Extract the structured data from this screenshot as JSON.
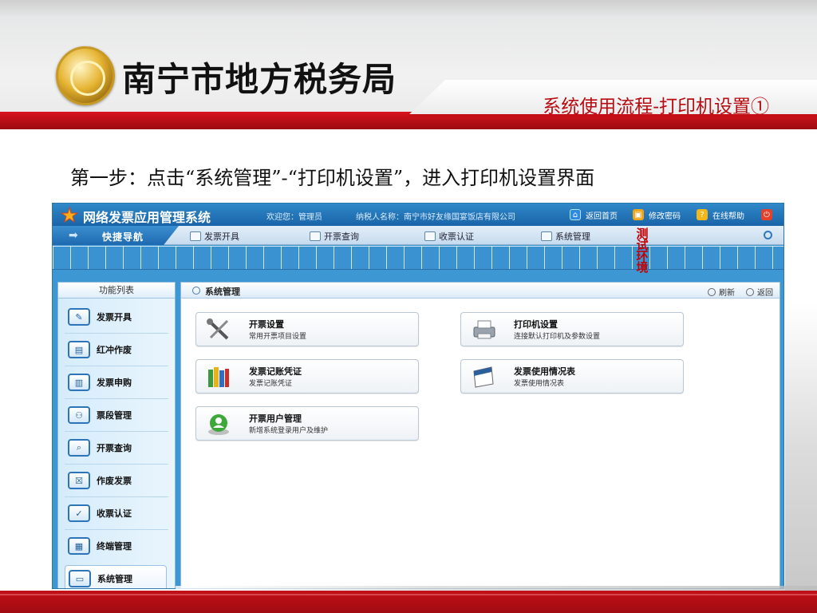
{
  "slide": {
    "agency_name": "南宁市地方税务局",
    "subtitle": "系统使用流程-打印机设置①",
    "step_text": "第一步：点击“系统管理”-“打印机设置”，进入打印机设置界面"
  },
  "app": {
    "title": "网络发票应用管理系统",
    "welcome": "欢迎您：管理员",
    "taxpayer": "纳税人名称：南宁市好友缘国宴饭店有限公司",
    "top_links": [
      "返回首页",
      "修改密码",
      "在线帮助"
    ],
    "quick_nav_label": "快捷导航",
    "nav_items": [
      "发票开具",
      "开票查询",
      "收票认证",
      "系统管理"
    ],
    "test_env_label": "测试环境",
    "sidebar_title": "功能列表",
    "sidebar_items": [
      "发票开具",
      "红冲作废",
      "发票申购",
      "票段管理",
      "开票查询",
      "作废发票",
      "收票认证",
      "终端管理",
      "系统管理"
    ],
    "sidebar_active": "系统管理",
    "panel_title": "系统管理",
    "refresh_label": "刷新",
    "back_label": "返回",
    "cards": [
      {
        "title": "开票设置",
        "subtitle": "常用开票项目设置"
      },
      {
        "title": "打印机设置",
        "subtitle": "连接默认打印机及参数设置"
      },
      {
        "title": "发票记账凭证",
        "subtitle": "发票记账凭证"
      },
      {
        "title": "发票使用情况表",
        "subtitle": "发票使用情况表"
      },
      {
        "title": "开票用户管理",
        "subtitle": "新增系统登录用户及维护"
      }
    ]
  },
  "colors": {
    "brand_red": "#c40f16",
    "app_blue": "#1f6fb5"
  }
}
